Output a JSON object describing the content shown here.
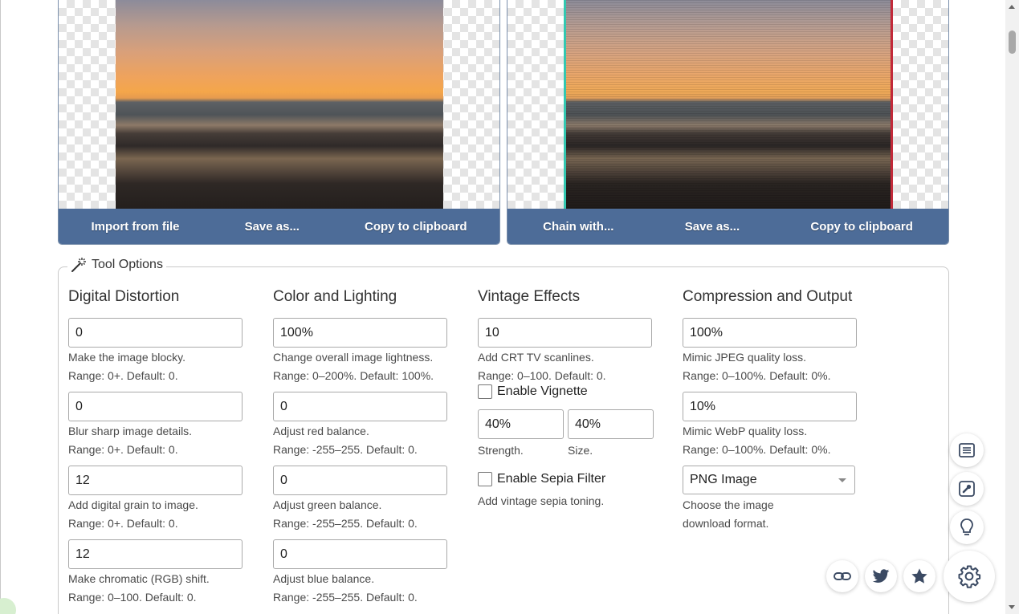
{
  "input_panel": {
    "buttons": [
      "Import from file",
      "Save as...",
      "Copy to clipboard"
    ]
  },
  "output_panel": {
    "buttons": [
      "Chain with...",
      "Save as...",
      "Copy to clipboard"
    ]
  },
  "tool_options": {
    "legend": "Tool Options",
    "digital_distortion": {
      "title": "Digital Distortion",
      "fields": [
        {
          "value": "0",
          "help1": "Make the image blocky.",
          "help2": "Range: 0+. Default: 0."
        },
        {
          "value": "0",
          "help1": "Blur sharp image details.",
          "help2": "Range: 0+. Default: 0."
        },
        {
          "value": "12",
          "help1": "Add digital grain to image.",
          "help2": "Range: 0+. Default: 0."
        },
        {
          "value": "12",
          "help1": "Make chromatic (RGB) shift.",
          "help2": "Range: 0–100. Default: 0."
        }
      ]
    },
    "color_lighting": {
      "title": "Color and Lighting",
      "fields": [
        {
          "value": "100%",
          "help1": "Change overall image lightness.",
          "help2": "Range: 0–200%. Default: 100%."
        },
        {
          "value": "0",
          "help1": "Adjust red balance.",
          "help2": "Range: -255–255. Default: 0."
        },
        {
          "value": "0",
          "help1": "Adjust green balance.",
          "help2": "Range: -255–255. Default: 0."
        },
        {
          "value": "0",
          "help1": "Adjust blue balance.",
          "help2": "Range: -255–255. Default: 0."
        }
      ]
    },
    "vintage": {
      "title": "Vintage Effects",
      "scanlines": {
        "value": "10",
        "help1": "Add CRT TV scanlines.",
        "help2": "Range: 0–100. Default: 0."
      },
      "vignette": {
        "label": "Enable Vignette",
        "checked": false,
        "strength": "40%",
        "size": "40%",
        "strength_label": "Strength.",
        "size_label": "Size."
      },
      "sepia": {
        "label": "Enable Sepia Filter",
        "checked": false,
        "help": "Add vintage sepia toning."
      }
    },
    "compression": {
      "title": "Compression and Output",
      "jpeg": {
        "value": "100%",
        "help1": "Mimic JPEG quality loss.",
        "help2": "Range: 0–100%. Default: 0%."
      },
      "webp": {
        "value": "10%",
        "help1": "Mimic WebP quality loss.",
        "help2": "Range: 0–100%. Default: 0%."
      },
      "format": {
        "selected": "PNG Image",
        "help1": "Choose the image",
        "help2": "download format."
      }
    }
  },
  "floating_actions": [
    "list-icon",
    "wrench-icon",
    "lightbulb-icon",
    "link-icon",
    "twitter-icon",
    "star-icon",
    "gear-icon"
  ],
  "colors": {
    "panel_bar": "#4d6c98",
    "icon": "#3b4a63"
  }
}
